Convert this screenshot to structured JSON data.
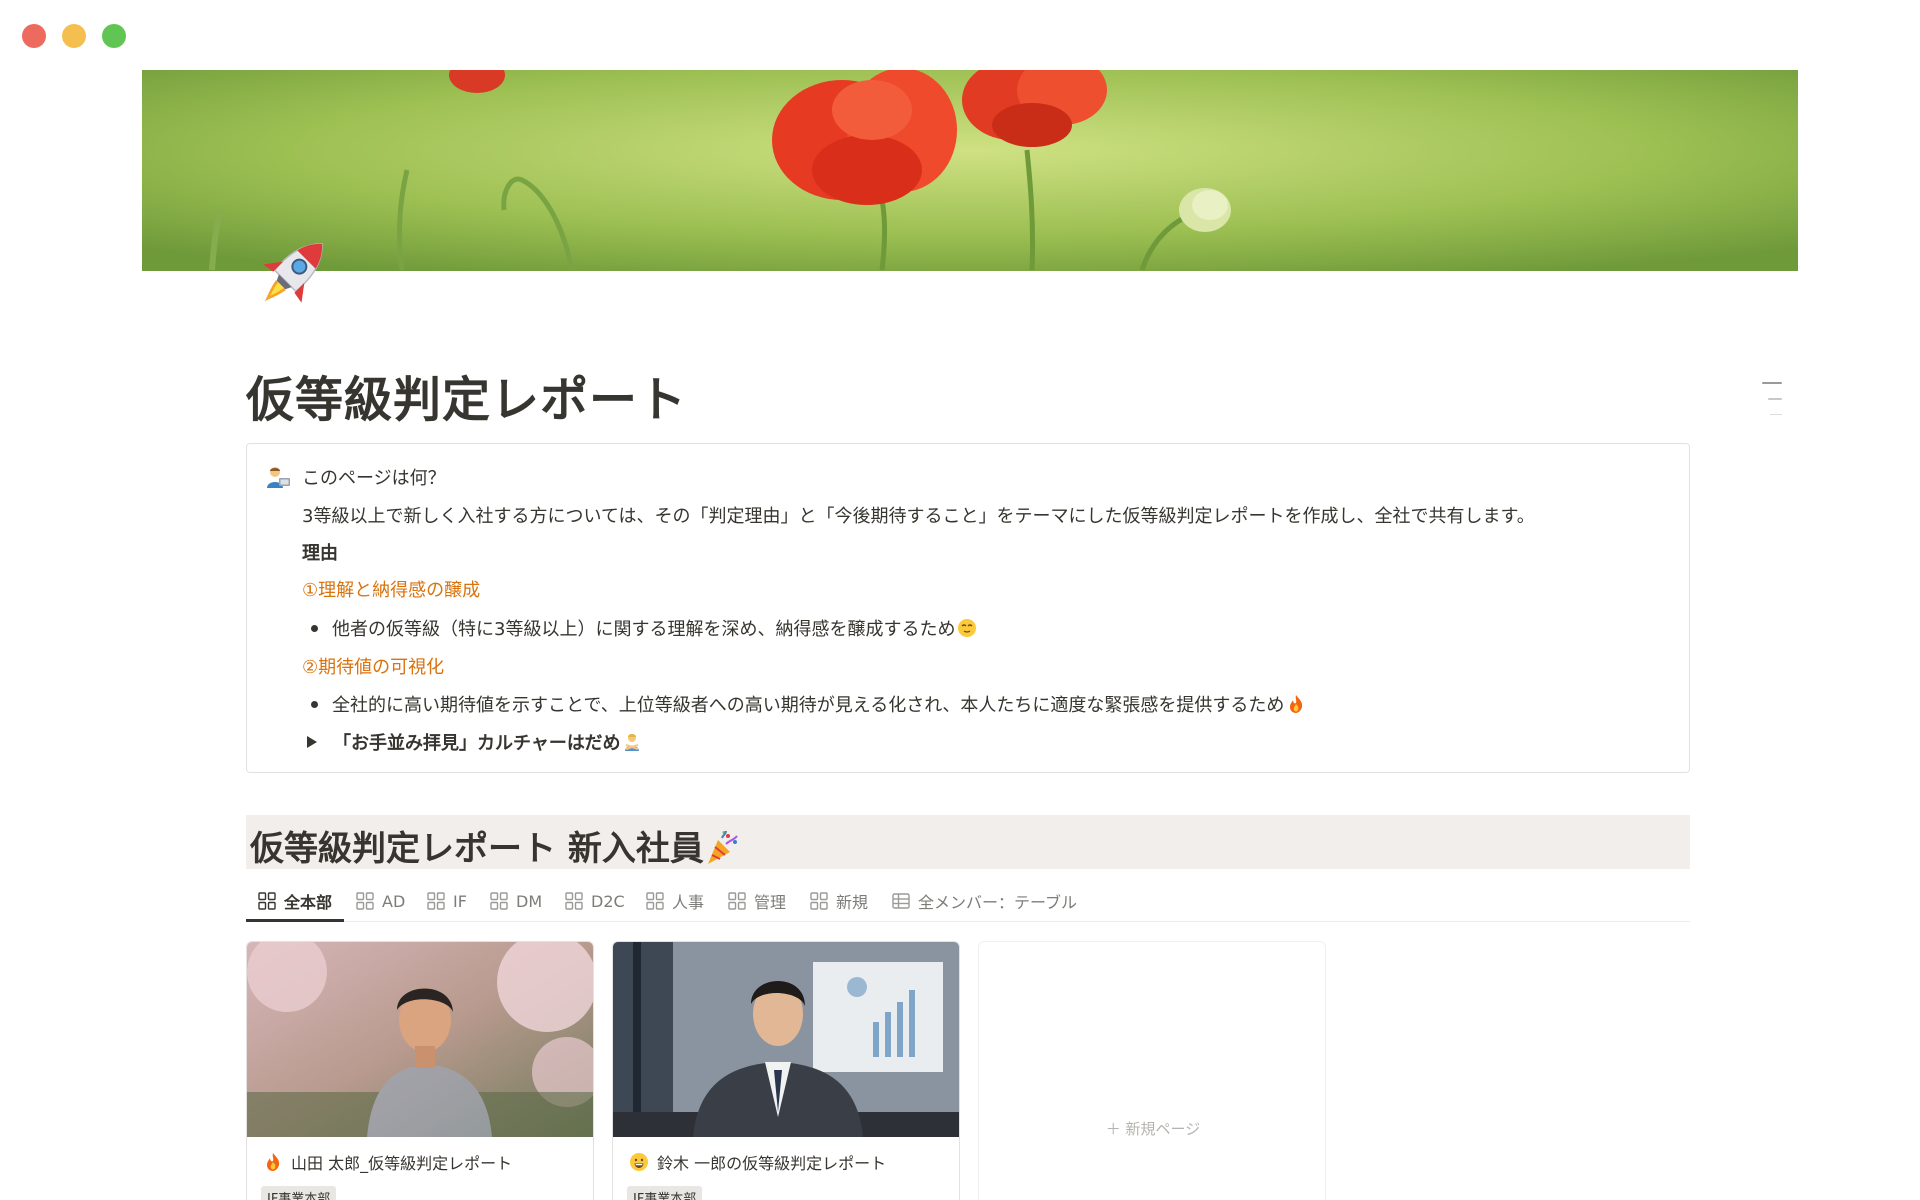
{
  "page": {
    "title": "仮等級判定レポート"
  },
  "callout": {
    "heading": "このページは何？",
    "intro": "3等級以上で新しく入社する方については、その「判定理由」と「今後期待すること」をテーマにした仮等級判定レポートを作成し、全社で共有します。",
    "reason_label": "理由",
    "point1_title": "①理解と納得感の醸成",
    "point1_bullet": "他者の仮等級（特に3等級以上）に関する理解を深め、納得感を醸成するため",
    "point2_title": "②期待値の可視化",
    "point2_bullet": "全社的に高い期待値を示すことで、上位等級者への高い期待が見える化され、本人たちに適度な緊張感を提供するため",
    "toggle_label": "「お手並み拝見」カルチャーはだめ"
  },
  "database": {
    "title": "仮等級判定レポート 新入社員",
    "tabs": [
      {
        "label": "全本部",
        "active": true
      },
      {
        "label": "AD"
      },
      {
        "label": "IF"
      },
      {
        "label": "DM"
      },
      {
        "label": "D2C"
      },
      {
        "label": "人事"
      },
      {
        "label": "管理"
      },
      {
        "label": "新規"
      },
      {
        "label": "全メンバー：テーブル"
      }
    ],
    "cards": [
      {
        "title": "山田 太郎_仮等級判定レポート",
        "tag": "IF事業本部"
      },
      {
        "title": "鈴木 一郎の仮等級判定レポート",
        "tag": "IF事業本部"
      }
    ],
    "new_page_label": "＋ 新規ページ"
  },
  "colors": {
    "accent_orange": "#d9730d",
    "text": "#37352f",
    "muted": "#7d7c78",
    "db_header_bg": "#f1eeec"
  },
  "icons": {
    "page_icon": "rocket-icon",
    "callout_icon": "person-at-computer-icon",
    "db_title_icon": "party-popper-icon",
    "card1_icon": "fire-icon",
    "card2_icon": "grinning-face-icon"
  }
}
